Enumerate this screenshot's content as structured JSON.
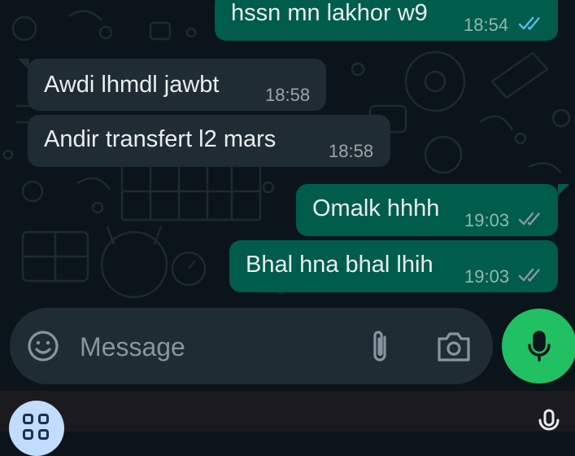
{
  "messages": [
    {
      "direction": "outgoing",
      "text": "hssn mn lakhor w9",
      "time": "18:54",
      "status": "read"
    },
    {
      "direction": "incoming",
      "text": "Awdi lhmdl jawbt",
      "time": "18:58"
    },
    {
      "direction": "incoming",
      "text": "Andir transfert l2 mars",
      "time": "18:58"
    },
    {
      "direction": "outgoing",
      "text": "Omalk hhhh",
      "time": "19:03",
      "status": "delivered"
    },
    {
      "direction": "outgoing",
      "text": "Bhal hna bhal lhih",
      "time": "19:03",
      "status": "delivered"
    }
  ],
  "composer": {
    "placeholder": "Message",
    "emoji_icon": "emoji-icon",
    "attach_icon": "paperclip-icon",
    "camera_icon": "camera-icon",
    "send_icon": "microphone-icon"
  },
  "nav_bar": {
    "apps_icon": "apps-grid-icon",
    "voice_icon": "microphone-icon"
  },
  "colors": {
    "chat_background": "#0b141a",
    "incoming_bubble": "#202c33",
    "outgoing_bubble": "#005c4b",
    "read_ticks": "#53bdeb",
    "delivered_ticks": "#8696a0",
    "mic_button": "#21c063"
  }
}
